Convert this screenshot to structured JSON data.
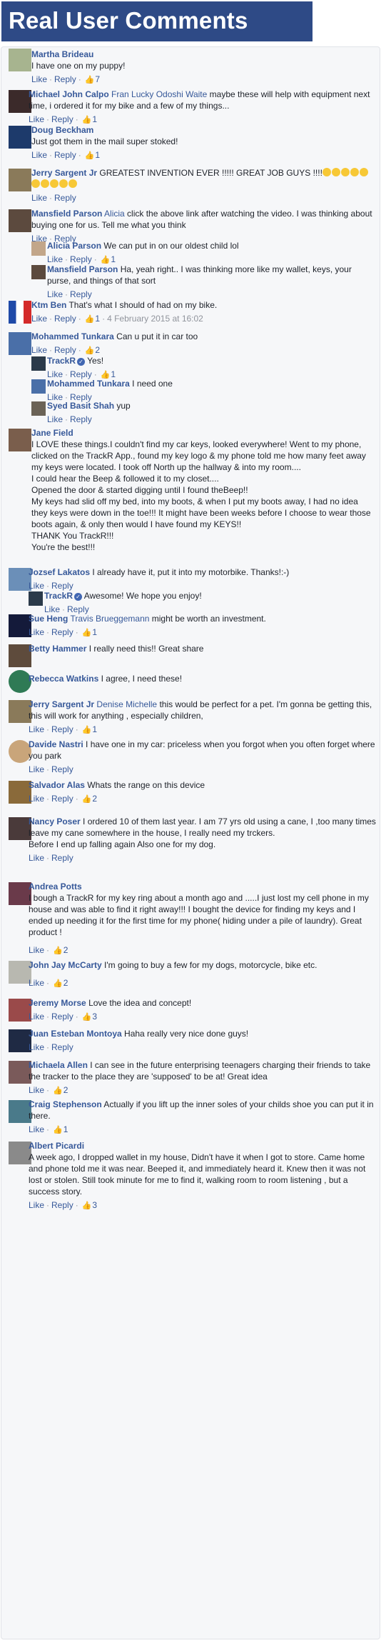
{
  "banner": {
    "title": "Real User Comments"
  },
  "actions": {
    "like": "Like",
    "reply": "Reply",
    "separator": "·"
  },
  "comments": [
    {
      "name": "Martha Brideau",
      "text": "I have one on my puppy!",
      "likes": "7"
    },
    {
      "name": "Michael John Calpo",
      "tag": "Fran Lucky Odoshi Waite",
      "text": " maybe these will help with equipment next time, i ordered it for my bike and a few of my things...",
      "likes": "1"
    },
    {
      "name": "Doug Beckham",
      "text": "Just got them in the mail super stoked!",
      "likes": "1"
    },
    {
      "name": "Jerry Sargent Jr",
      "text": " GREATEST INVENTION EVER !!!!! GREAT JOB GUYS !!!!",
      "emoji_count": 10
    },
    {
      "name": "Mansfield Parson",
      "tag": "Alicia",
      "text": " click the above link after watching the video. I was thinking about buying one for us. Tell me what you think",
      "replies": [
        {
          "name": "Alicia Parson",
          "text": "We can put in on our oldest child lol",
          "likes": "1"
        },
        {
          "name": "Mansfield Parson",
          "text": "Ha, yeah right.. I was thinking more like my wallet, keys, your purse, and things of that sort"
        }
      ]
    },
    {
      "name": "Ktm Ben",
      "text": "That's what I should of had on my bike.",
      "likes": "1",
      "time": "4 February 2015 at 16:02"
    },
    {
      "name": "Mohammed Tunkara",
      "text": "Can u put it in car too",
      "likes": "2",
      "replies": [
        {
          "name": "TrackR",
          "verified": true,
          "text": "Yes!",
          "likes": "1"
        },
        {
          "name": "Mohammed Tunkara",
          "text": "I need one"
        },
        {
          "name": "Syed Basit Shah",
          "text": "yup"
        }
      ]
    },
    {
      "name": "Jane Field",
      "lines": [
        "I LOVE these things.I couldn't find my car keys, looked everywhere! Went to my phone, clicked on the TrackR App., found my key logo & my phone told me how many feet away my keys were located. I took off North up the hallway & into my room....",
        "I could hear the Beep & followed it to my closet....",
        "Opened the door & started digging until I found theBeep!!",
        "My keys had slid off my bed, into my boots, & when I put my boots away, I had no idea they keys were down in the toe!!! It might  have been weeks before I choose to wear those boots again, & only then would I have found my KEYS!!",
        "THANK You TrackR!!!",
        "You're the best!!!"
      ]
    },
    {
      "name": "Jozsef Lakatos",
      "text": "I already have it, put it into my motorbike. Thanks!:-)",
      "replies": [
        {
          "name": "TrackR",
          "verified": true,
          "text": "Awesome! We hope you enjoy!"
        }
      ]
    },
    {
      "name": "Sue Heng",
      "tag": "Travis Brueggemann",
      "text": " might be worth an investment.",
      "likes": "1"
    },
    {
      "name": "Betty Hammer",
      "text": "I really need this!! Great share"
    },
    {
      "name": "Rebecca Watkins",
      "text": "I agree, I need these!"
    },
    {
      "name": "Jerry Sargent Jr",
      "tag": "Denise Michelle",
      "text": " this would be perfect for a pet. I'm gonna be getting this, this will work for anything , especially children,",
      "likes": "1"
    },
    {
      "name": "Davide Nastri",
      "text": "I have one in my car: priceless when you forgot when you often forget where you park"
    },
    {
      "name": "Salvador Alas",
      "text": "Whats the range on this device",
      "likes": "2"
    },
    {
      "name": "Nancy Poser",
      "text": "I ordered 10 of them last year. I am 77 yrs old using a cane, I ,too many times leave my cane somewhere in the house, I really need my trckers.",
      "extra": "Before I end up falling again Also one for my dog."
    },
    {
      "name": "Andrea Potts",
      "lines": [
        "I bough a TrackR for my key ring about a month ago and .....I just lost my cell phone in my house and was able to find it right away!!! I bought the device for finding my keys and I ended up needing it for the first time for my phone( hiding under a pile of laundry). Great product !"
      ],
      "likes": "2"
    },
    {
      "name": "John Jay McCarty",
      "text": "I'm going to buy a few for my dogs, motorcycle, bike etc.",
      "likes": "2"
    },
    {
      "name": "Jeremy Morse",
      "text": "Love the idea and concept!",
      "likes": "3"
    },
    {
      "name": "Juan Esteban Montoya",
      "text": "Haha really very nice done guys!"
    },
    {
      "name": "Michaela Allen",
      "text": "I can see in the future enterprising teenagers charging their friends to take the tracker to the place they are 'supposed' to be at! Great idea",
      "likes": "2"
    },
    {
      "name": "Craig Stephenson",
      "text": "Actually if you lift up the inner soles of your childs shoe you can put it in there.",
      "likes": "1"
    },
    {
      "name": "Albert Picardi",
      "lines": [
        "A week ago, I dropped wallet in my house, Didn't have it when I got to store. Came home and phone told me it was near. Beeped it, and immediately heard it. Knew then it was not lost or stolen. Still took minute for me to find it, walking room to room listening , but a success story."
      ],
      "likes": "3"
    }
  ]
}
